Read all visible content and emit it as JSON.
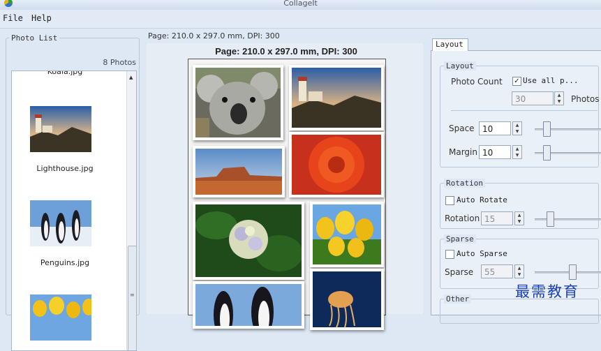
{
  "window": {
    "title": "CollageIt"
  },
  "menu": {
    "file": "File",
    "help": "Help"
  },
  "photo_list": {
    "legend": "Photo List",
    "count": "8 Photos",
    "items": [
      {
        "label": "Koala.jpg"
      },
      {
        "label": "Lighthouse.jpg"
      },
      {
        "label": "Penguins.jpg"
      }
    ]
  },
  "canvas": {
    "info": "Page: 210.0 x 297.0 mm, DPI: 300",
    "title": "Page: 210.0 x 297.0 mm, DPI: 300"
  },
  "settings": {
    "tab": "Layout",
    "layout": {
      "legend": "Layout",
      "photo_count_label": "Photo Count",
      "use_all_label": "Use all p...",
      "use_all_checked": true,
      "count_value": "30",
      "photos_label": "Photos",
      "space_label": "Space",
      "space_value": "10",
      "margin_label": "Margin",
      "margin_value": "10"
    },
    "rotation": {
      "legend": "Rotation",
      "auto_label": "Auto Rotate",
      "auto_checked": false,
      "label": "Rotation",
      "value": "15"
    },
    "sparse": {
      "legend": "Sparse",
      "auto_label": "Auto Sparse",
      "auto_checked": false,
      "label": "Sparse",
      "value": "55"
    },
    "other": {
      "legend": "Other"
    }
  },
  "watermark": "最需教育"
}
